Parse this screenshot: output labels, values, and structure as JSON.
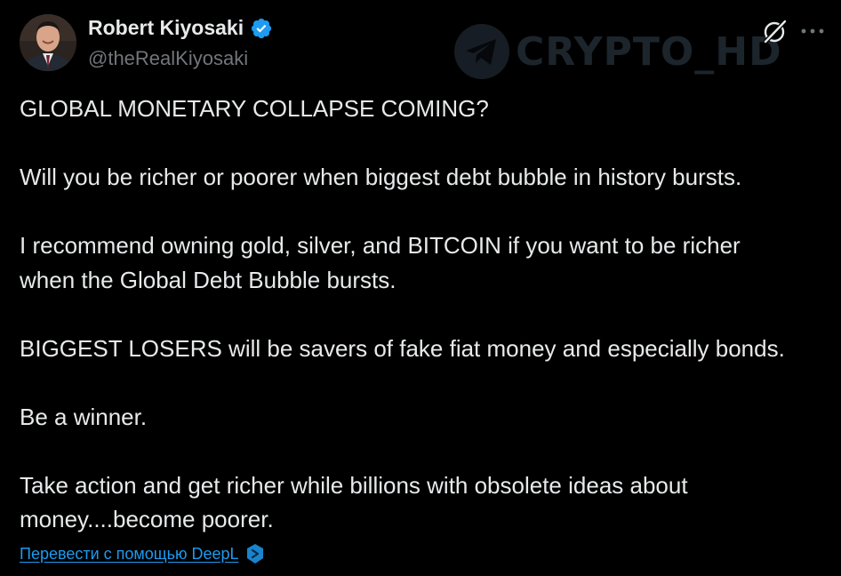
{
  "author": {
    "display_name": "Robert Kiyosaki",
    "handle": "@theRealKiyosaki",
    "verified": true,
    "avatar_icon": "portrait-avatar"
  },
  "watermark": {
    "text": "CRYPTO_HD",
    "icon": "telegram-icon"
  },
  "actions": {
    "grok_icon": "grok-icon",
    "more_icon": "more-dots-icon"
  },
  "tweet": {
    "paragraphs": [
      [
        "GLOBAL MONETARY COLLAPSE COMING?"
      ],
      [
        "Will you be richer or poorer when biggest debt bubble  in history bursts."
      ],
      [
        "I recommend owning gold, silver, and BITCOIN if you want to be richer",
        "when the Global Debt Bubble bursts."
      ],
      [
        "BIGGEST LOSERS will be savers of fake fiat money and especially bonds."
      ],
      [
        "Be a winner."
      ],
      [
        "Take action and get richer while billions with obsolete ideas about",
        "money....become poorer."
      ]
    ]
  },
  "translate": {
    "label": "Перевести с помощью DeepL",
    "icon": "deepl-icon"
  },
  "colors": {
    "background": "#000000",
    "text": "#e7e9ea",
    "secondary": "#71767b",
    "link": "#1d9bf0",
    "verified": "#1d9bf0"
  }
}
